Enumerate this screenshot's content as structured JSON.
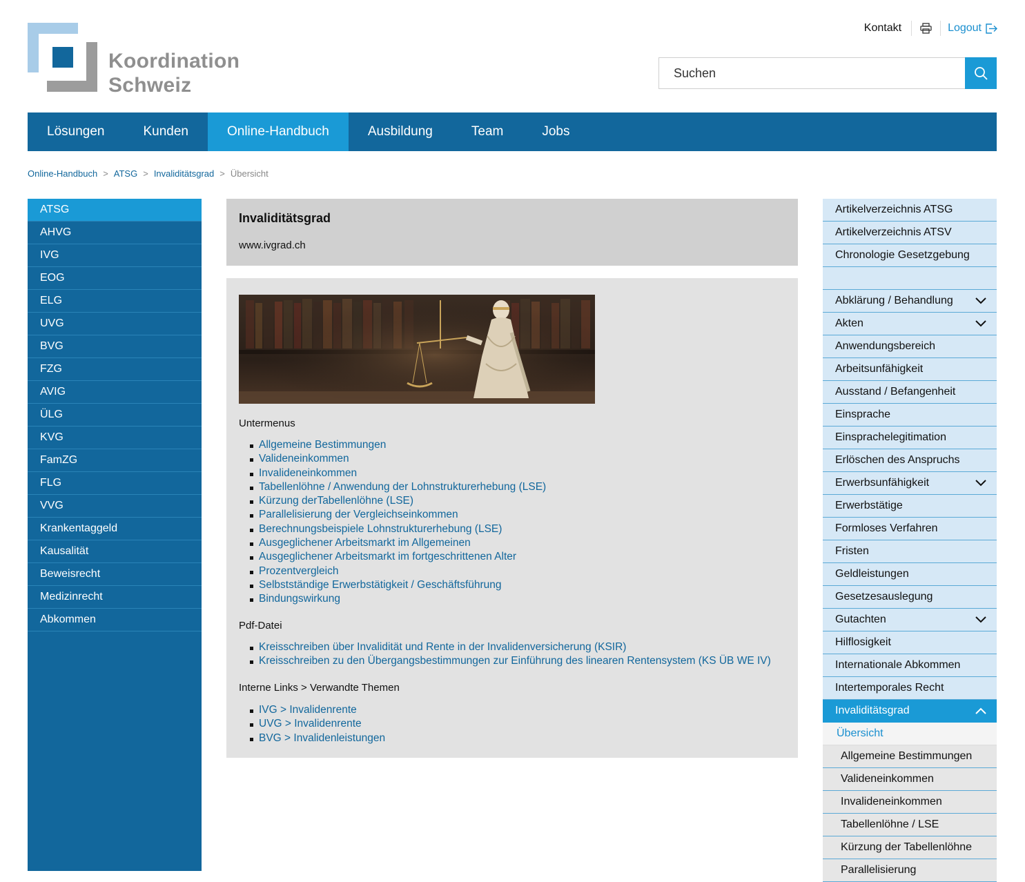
{
  "header": {
    "logo_line1": "Koordination",
    "logo_line2": "Schweiz",
    "kontakt": "Kontakt",
    "logout": "Logout",
    "search_placeholder": "Suchen"
  },
  "mainnav": [
    "Lösungen",
    "Kunden",
    "Online-Handbuch",
    "Ausbildung",
    "Team",
    "Jobs"
  ],
  "mainnav_active": "Online-Handbuch",
  "breadcrumb": {
    "items": [
      "Online-Handbuch",
      "ATSG",
      "Invaliditätsgrad"
    ],
    "current": "Übersicht",
    "separator": ">"
  },
  "leftnav": [
    "ATSG",
    "AHVG",
    "IVG",
    "EOG",
    "ELG",
    "UVG",
    "BVG",
    "FZG",
    "AVIG",
    "ÜLG",
    "KVG",
    "FamZG",
    "FLG",
    "VVG",
    "Krankentaggeld",
    "Kausalität",
    "Beweisrecht",
    "Medizinrecht",
    "Abkommen"
  ],
  "leftnav_active": "ATSG",
  "content": {
    "title": "Invaliditätsgrad",
    "url": "www.ivgrad.ch",
    "untermenus_label": "Untermenus",
    "untermenus": [
      "Allgemeine Bestimmungen",
      "Valideneinkommen",
      "Invalideneinkommen",
      "Tabellenlöhne / Anwendung der Lohnstrukturerhebung (LSE)",
      "Kürzung derTabellenlöhne (LSE)",
      "Parallelisierung der Vergleichseinkommen",
      "Berechnungsbeispiele Lohnstrukturerhebung (LSE)",
      "Ausgeglichener Arbeitsmarkt im Allgemeinen",
      "Ausgeglichener Arbeitsmarkt im fortgeschrittenen Alter",
      "Prozentvergleich",
      "Selbstständige Erwerbstätigkeit / Geschäftsführung",
      "Bindungswirkung"
    ],
    "pdf_label": "Pdf-Datei",
    "pdf": [
      "Kreisschreiben über Invalidität und Rente in der Invalidenversicherung (KSIR)",
      "Kreisschreiben zu den Übergangsbestimmungen zur Einführung des linearen Rentensystem (KS ÜB WE IV)"
    ],
    "interne_label": "Interne Links > Verwandte Themen",
    "interne": [
      "IVG > Invalidenrente",
      "UVG > Invalidenrente",
      "BVG > Invalidenleistungen"
    ]
  },
  "rightnav": [
    {
      "label": "Artikelverzeichnis ATSG",
      "type": "item"
    },
    {
      "label": "Artikelverzeichnis ATSV",
      "type": "item"
    },
    {
      "label": "Chronologie Gesetzgebung",
      "type": "item"
    },
    {
      "label": "",
      "type": "blank"
    },
    {
      "label": "Abklärung / Behandlung",
      "type": "item",
      "chevron": "down"
    },
    {
      "label": "Akten",
      "type": "item",
      "chevron": "down"
    },
    {
      "label": "Anwendungsbereich",
      "type": "item"
    },
    {
      "label": "Arbeitsunfähigkeit",
      "type": "item"
    },
    {
      "label": "Ausstand / Befangenheit",
      "type": "item"
    },
    {
      "label": "Einsprache",
      "type": "item"
    },
    {
      "label": "Einsprachelegitimation",
      "type": "item"
    },
    {
      "label": "Erlöschen des Anspruchs",
      "type": "item"
    },
    {
      "label": "Erwerbsunfähigkeit",
      "type": "item",
      "chevron": "down"
    },
    {
      "label": "Erwerbstätige",
      "type": "item"
    },
    {
      "label": "Formloses Verfahren",
      "type": "item"
    },
    {
      "label": "Fristen",
      "type": "item"
    },
    {
      "label": "Geldleistungen",
      "type": "item"
    },
    {
      "label": "Gesetzesauslegung",
      "type": "item"
    },
    {
      "label": "Gutachten",
      "type": "item",
      "chevron": "down"
    },
    {
      "label": "Hilflosigkeit",
      "type": "item"
    },
    {
      "label": "Internationale Abkommen",
      "type": "item"
    },
    {
      "label": "Intertemporales Recht",
      "type": "item"
    },
    {
      "label": "Invaliditätsgrad",
      "type": "active",
      "chevron": "up"
    },
    {
      "label": "Übersicht",
      "type": "sub1"
    },
    {
      "label": "Allgemeine Bestimmungen",
      "type": "sub"
    },
    {
      "label": "Valideneinkommen",
      "type": "sub"
    },
    {
      "label": "Invalideneinkommen",
      "type": "sub"
    },
    {
      "label": "Tabellenlöhne / LSE",
      "type": "sub"
    },
    {
      "label": "Kürzung der Tabellenlöhne",
      "type": "sub"
    },
    {
      "label": "Parallelisierung",
      "type": "sub"
    }
  ],
  "colors": {
    "nav_dark": "#12679c",
    "nav_active": "#1a9ad6",
    "right_bg": "#d6e8f6",
    "link": "#12679c"
  },
  "icons": {
    "print": "printer-icon",
    "logout": "logout-icon",
    "search": "search-icon",
    "chevron": "chevron-icon"
  }
}
